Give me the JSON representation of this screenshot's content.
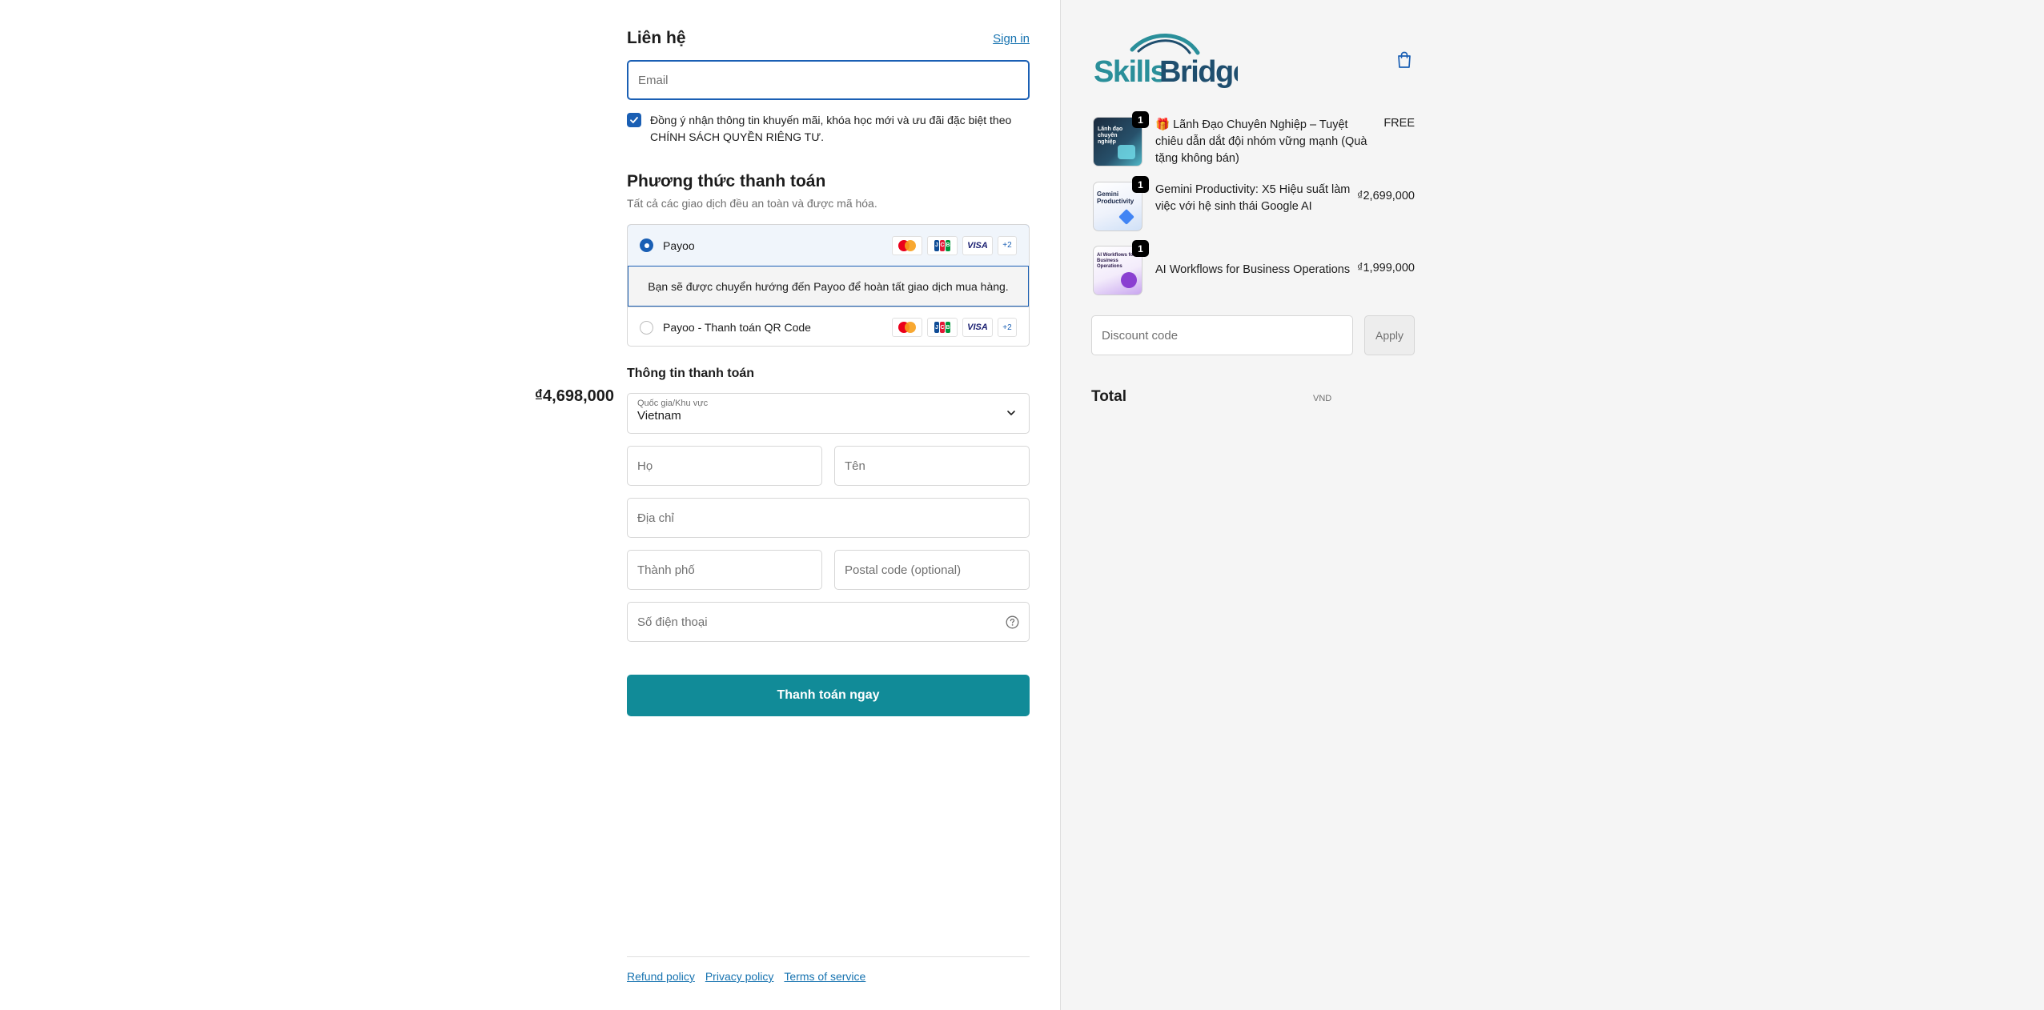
{
  "contact": {
    "title": "Liên hệ",
    "sign_in": "Sign in",
    "email_placeholder": "Email",
    "consent_text": "Đồng ý nhận thông tin khuyến mãi, khóa học mới và ưu đãi đặc biệt theo CHÍNH SÁCH QUYỀN RIÊNG TƯ.",
    "consent_checked": true
  },
  "payment": {
    "title": "Phương thức thanh toán",
    "subtitle": "Tất cả các giao dịch đều an toàn và được mã hóa.",
    "options": [
      {
        "label": "Payoo",
        "selected": true,
        "more_cards": "+2"
      },
      {
        "label": "Payoo - Thanh toán QR Code",
        "selected": false,
        "more_cards": "+2"
      }
    ],
    "redirect_text": "Bạn sẽ được chuyển hướng đến Payoo để hoàn tất giao dịch mua hàng.",
    "card_brands": [
      "mastercard-icon",
      "jcb-icon",
      "visa-icon"
    ],
    "visa_text": "VISA"
  },
  "billing": {
    "title": "Thông tin thanh toán",
    "country_label": "Quốc gia/Khu vực",
    "country_value": "Vietnam",
    "last_name_placeholder": "Họ",
    "first_name_placeholder": "Tên",
    "address_placeholder": "Địa chỉ",
    "city_placeholder": "Thành phố",
    "postal_placeholder": "Postal code (optional)",
    "phone_placeholder": "Số điện thoại"
  },
  "pay_button": "Thanh toán ngay",
  "footer": {
    "refund": "Refund policy",
    "privacy": "Privacy policy",
    "terms": "Terms of service"
  },
  "brand": {
    "logo_text_1": "Skills",
    "logo_text_2": "Bridge",
    "accent": "#118b98",
    "link": "#1773b0",
    "focus": "#1a5fb4"
  },
  "cart": {
    "items": [
      {
        "name": "🎁 Lãnh Đạo Chuyên Nghiệp – Tuyệt chiêu dẫn dắt đội nhóm vững mạnh (Quà tặng không bán)",
        "price": "FREE",
        "qty": "1",
        "thumb_text": "Lãnh đạo chuyên nghiệp"
      },
      {
        "name": "Gemini Productivity: X5 Hiệu suất làm việc với hệ sinh thái Google AI",
        "price": "₫2,699,000",
        "qty": "1",
        "thumb_text": "Gemini Productivity"
      },
      {
        "name": "AI Workflows for Business Operations",
        "price": "₫1,999,000",
        "qty": "1",
        "thumb_text": "AI Workflows for Business Operations"
      }
    ],
    "discount_placeholder": "Discount code",
    "apply_label": "Apply",
    "total_label": "Total",
    "total_currency": "VND",
    "total_value": "₫4,698,000"
  }
}
